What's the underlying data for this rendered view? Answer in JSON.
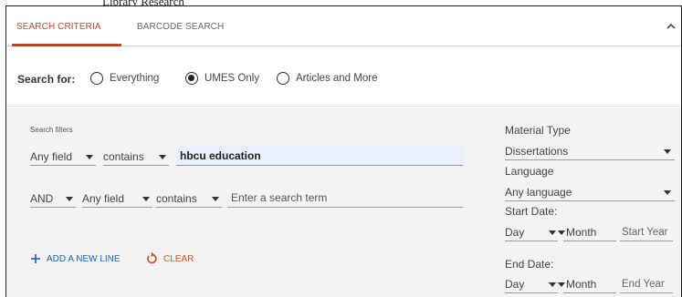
{
  "header_fragment": "Library Research",
  "tabs": [
    {
      "label": "SEARCH CRITERIA",
      "active": true
    },
    {
      "label": "BARCODE SEARCH",
      "active": false
    }
  ],
  "search_for": {
    "label": "Search for:",
    "options": [
      {
        "label": "Everything",
        "checked": false
      },
      {
        "label": "UMES Only",
        "checked": true
      },
      {
        "label": "Articles and More",
        "checked": false
      }
    ]
  },
  "filters": {
    "title": "Search filters",
    "line1": {
      "field": "Any field",
      "operator": "contains",
      "value": "hbcu education"
    },
    "line2": {
      "boolean": "AND",
      "field": "Any field",
      "operator": "contains",
      "placeholder": "Enter a search term"
    },
    "add_line_label": "ADD A NEW LINE",
    "clear_label": "CLEAR"
  },
  "side": {
    "material_type_label": "Material Type",
    "material_type_value": "Dissertations",
    "language_label": "Language",
    "language_value": "Any language",
    "start_date_label": "Start Date:",
    "end_date_label": "End Date:",
    "day_label": "Day",
    "month_label": "Month",
    "start_year_placeholder": "Start Year",
    "end_year_placeholder": "End Year"
  },
  "colors": {
    "active_tab": "#b34a2a",
    "add_link": "#1e63b8",
    "clear_link": "#c05a23",
    "filter_bg": "#f3f3f3",
    "filled_input_bg": "#e8f0fb"
  },
  "icons": [
    "chevron-up-icon",
    "plus-icon",
    "refresh-icon",
    "caret-down-icon"
  ]
}
